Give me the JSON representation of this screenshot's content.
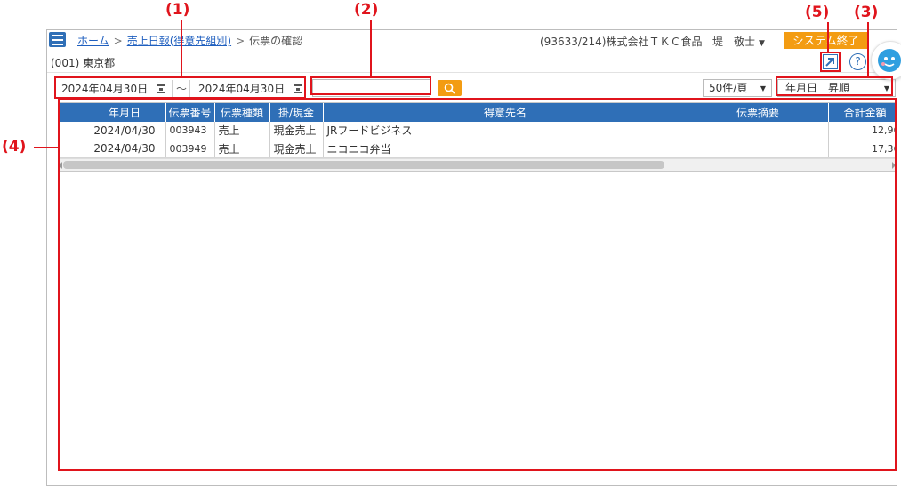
{
  "callouts": {
    "c1": "(1)",
    "c2": "(2)",
    "c3": "(3)",
    "c4": "(4)",
    "c5": "(5)"
  },
  "titlebar": {
    "breadcrumb": [
      "ホーム",
      "売上日報(得意先組別)",
      "伝票の確認"
    ],
    "separator": ">",
    "company": "(93633/214)株式会社ＴＫＣ食品",
    "user": "堤　敬士",
    "user_caret": "▼",
    "exit_label": "システム終了"
  },
  "office": "(001) 東京都",
  "icons": {
    "popout": "external-link-icon",
    "help_glyph": "?"
  },
  "filter": {
    "date_from": "2024年04月30日",
    "date_to": "2024年04月30日",
    "tilde": "～",
    "search_value": "",
    "page_size": "50件/頁",
    "sort": "年月日　昇順",
    "caret": "▼"
  },
  "grid": {
    "columns": [
      "",
      "年月日",
      "伝票番号",
      "伝票種類",
      "掛/現金",
      "得意先名",
      "伝票摘要",
      "合計金額"
    ],
    "rows": [
      [
        "",
        "2024/04/30",
        "003943",
        "売上",
        "現金売上",
        "JRフードビジネス",
        "",
        "12,96"
      ],
      [
        "",
        "2024/04/30",
        "003949",
        "売上",
        "現金売上",
        "ニコニコ弁当",
        "",
        "17,36"
      ]
    ]
  },
  "colors": {
    "brand_blue": "#2f6fb7",
    "accent_orange": "#f39c12",
    "callout_red": "#e0141c"
  }
}
